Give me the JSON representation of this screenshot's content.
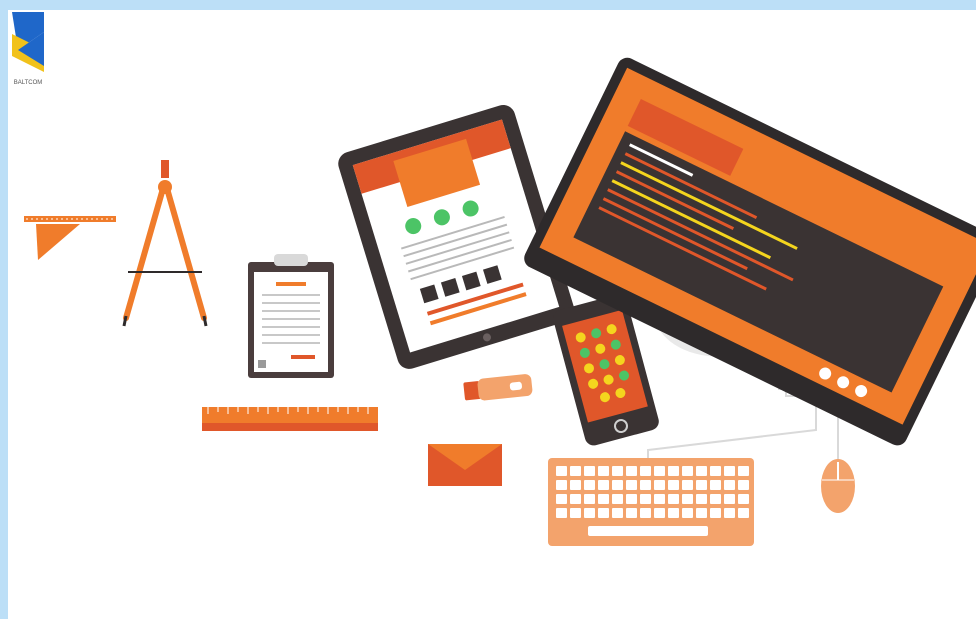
{
  "scene": {
    "description_items": [
      "drafting-triangle-ruler",
      "drafting-compass",
      "clipboard",
      "tablet",
      "smartphone",
      "usb-drive",
      "ruler",
      "envelope",
      "keyboard",
      "desktop-monitor",
      "mouse"
    ]
  },
  "colors": {
    "accent": "#f07c2b",
    "accent_dark": "#e0572a",
    "dark": "#2e2a2b",
    "tablet_frame": "#3a3333",
    "green": "#4cc466",
    "yellow": "#f4d51e",
    "background": "#ffffff",
    "frame": "#bcdff7"
  },
  "logo": {
    "text": "BALTCOM"
  }
}
